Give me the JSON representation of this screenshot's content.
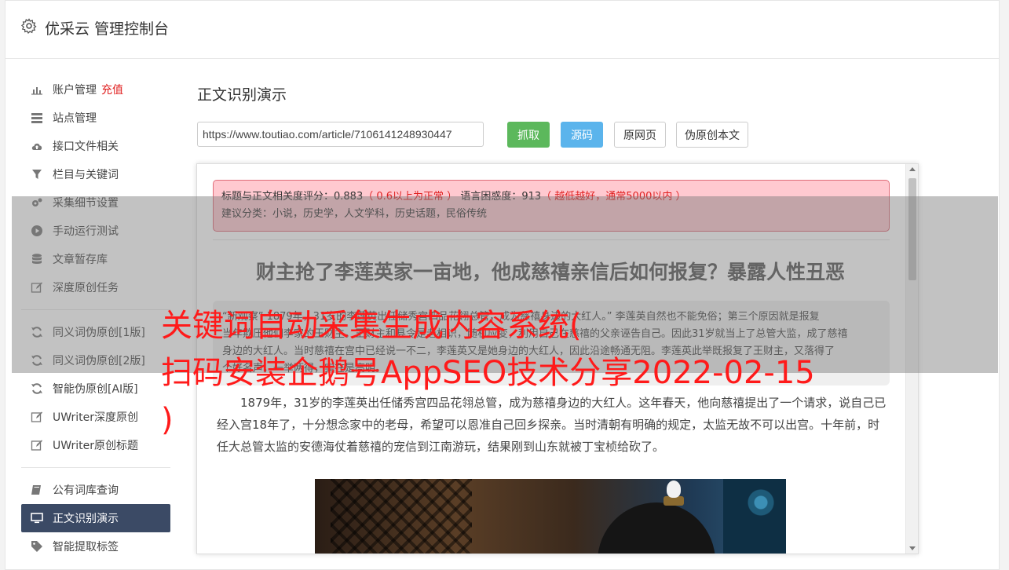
{
  "header": {
    "title": "优采云 管理控制台",
    "icon": "gear-icon"
  },
  "sidebar": {
    "group1": [
      {
        "label": "账户管理",
        "badge": "充值",
        "icon": "bar-chart-icon"
      },
      {
        "label": "站点管理",
        "icon": "server-icon"
      },
      {
        "label": "接口文件相关",
        "icon": "cloud-upload-icon"
      },
      {
        "label": "栏目与关键词",
        "icon": "filter-icon"
      },
      {
        "label": "采集细节设置",
        "icon": "cogs-icon"
      },
      {
        "label": "手动运行测试",
        "icon": "play-circle-icon"
      },
      {
        "label": "文章暂存库",
        "icon": "database-icon"
      },
      {
        "label": "深度原创任务",
        "icon": "edit-icon"
      }
    ],
    "group2": [
      {
        "label": "同义词伪原创[1版]",
        "icon": "refresh-icon"
      },
      {
        "label": "同义词伪原创[2版]",
        "icon": "refresh-icon"
      },
      {
        "label": "智能伪原创[AI版]",
        "icon": "refresh-icon"
      },
      {
        "label": "UWriter深度原创",
        "icon": "edit-icon"
      },
      {
        "label": "UWriter原创标题",
        "icon": "edit-icon"
      }
    ],
    "group3": [
      {
        "label": "公有词库查询",
        "icon": "book-icon"
      },
      {
        "label": "正文识别演示",
        "icon": "desktop-icon"
      },
      {
        "label": "智能提取标签",
        "icon": "tag-icon"
      }
    ]
  },
  "main": {
    "title": "正文识别演示",
    "url_value": "https://www.toutiao.com/article/7106141248930447",
    "buttons": {
      "fetch": "抓取",
      "source": "源码",
      "original": "原网页",
      "rewrite": "伪原创本文"
    }
  },
  "result": {
    "score_label": "标题与正文相关度评分：0.883",
    "score_note": "（ 0.6以上为正常 ）",
    "perplexity_label": "语言困惑度：913",
    "perplexity_note": "（ 越低越好，通常5000以内 ）",
    "suggest": "建议分类：小说，历史学，人文学科，历史话题，民俗传统",
    "article_title": "财主抢了李莲英家一亩地，他成慈禧亲信后如何报复？暴露人性丑恶",
    "quote_line1": "“新观察”  1879年，31岁的李莲英出任储秀宫四品花翎总管，成为慈禧身边的大红人。”  李莲英自然也不能免俗；第三个原因就是报复",
    "quote_line2": "当年欺压他们李家的王财主。王财主和县令是老相识，随机应变，利用自己在慈禧的父亲诬告自己。因此31岁就当上了总管大监，成了慈禧",
    "quote_line3": "身边的大红人。当时慈禧在宫中已经说一不二，李莲英又是她身边的大红人，因此沿途畅通无阻。李莲英此举既报复了王财主，又落得了",
    "quote_line4": "个好名声，一举两得，实在是高明。",
    "paragraph": "1879年，31岁的李莲英出任储秀宫四品花翎总管，成为慈禧身边的大红人。这年春天，他向慈禧提出了一个请求，说自己已经入宫18年了，十分想念家中的老母，希望可以恩准自己回乡探亲。当时清朝有明确的规定，太监无故不可以出宫。十年前，时任大总管太监的安德海仗着慈禧的宠信到江南游玩，结果刚到山东就被丁宝桢给砍了。"
  },
  "overlay": {
    "line1": "关键词自动采集生成内容系统(",
    "line2": "扫码安装企鹅号AppSEO技术分享2022-02-15",
    "line3": ")"
  }
}
